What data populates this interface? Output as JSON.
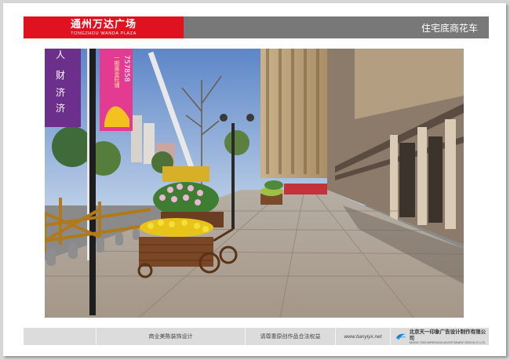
{
  "header": {
    "brand_cn": "通州万达广场",
    "brand_en": "TONGZHOU WANDA PLAZA",
    "page_title": "住宅底商花车"
  },
  "photo": {
    "banner_left": [
      "人",
      "财",
      "济",
      "济"
    ],
    "banner_right_num": "757858",
    "banner_right_text": "一期黄金旺铺"
  },
  "footer": {
    "item1": "商业美陈装饰设计",
    "item2": "请尊重原创作品合法权益",
    "website": "www.tianyiyx.net",
    "company_cn": "北京天一印象广告设计制作有限公司",
    "company_en": "BEIJING TEEN IMPRESSION ADVERTISEMENT DESIGN CO.,LTD."
  },
  "colors": {
    "brand_red": "#e0121f",
    "title_gray": "#787878",
    "footer_gray": "#dcdcdc"
  }
}
